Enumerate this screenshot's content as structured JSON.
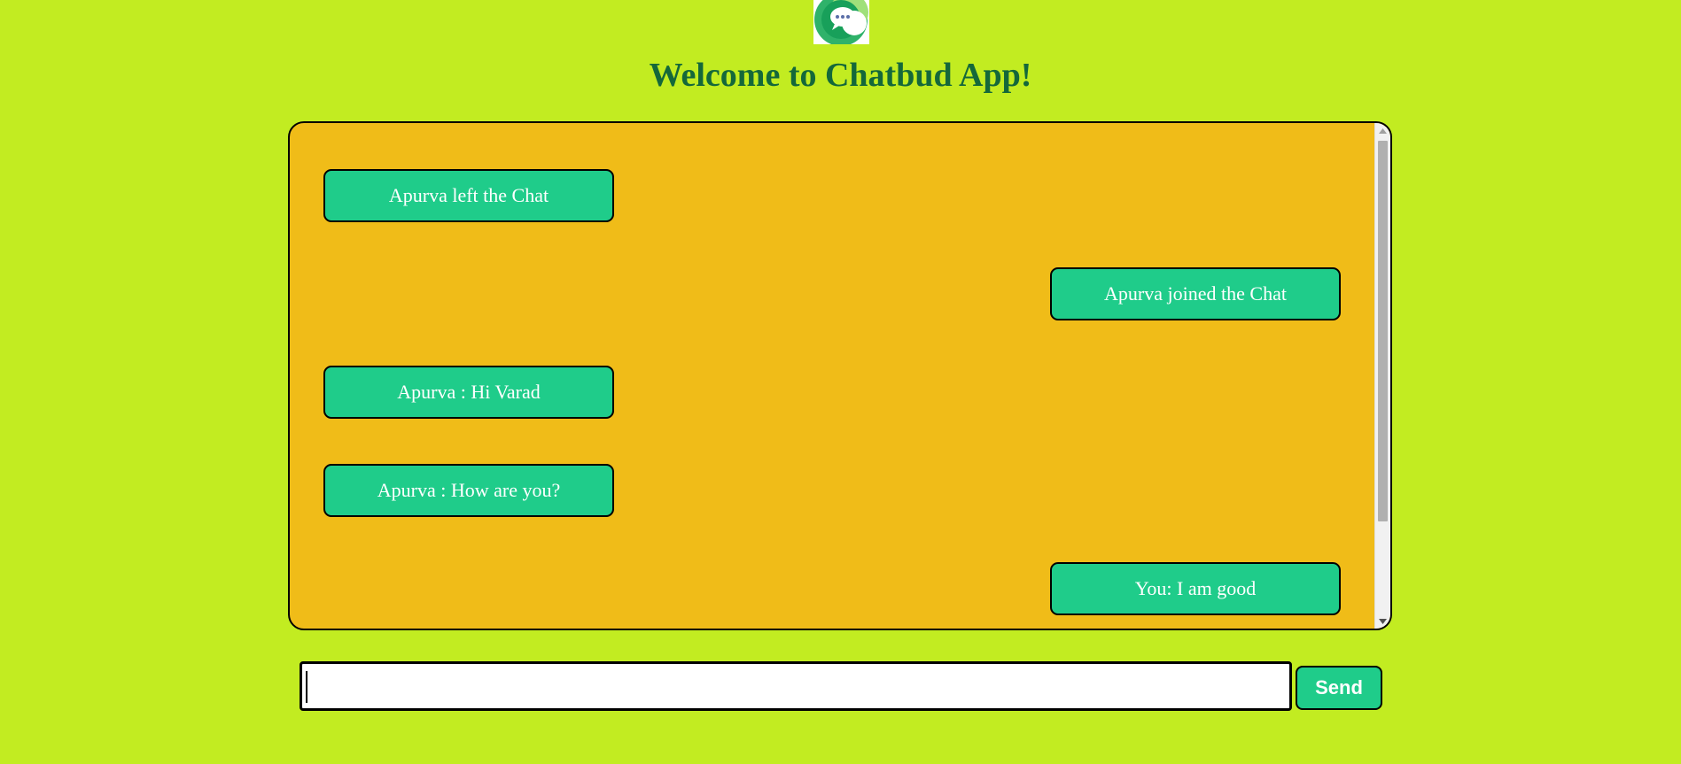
{
  "app": {
    "logo_icon": "chat-bubble-logo-icon",
    "title": "Welcome to Chatbud App!"
  },
  "chat": {
    "messages": [
      {
        "text": "Apurva left the Chat",
        "side": "left"
      },
      {
        "text": "Apurva joined the Chat",
        "side": "right"
      },
      {
        "text": "Apurva : Hi Varad",
        "side": "left"
      },
      {
        "text": "Apurva : How are you?",
        "side": "left"
      },
      {
        "text": "You: I am good",
        "side": "right"
      }
    ]
  },
  "composer": {
    "input_value": "",
    "input_placeholder": "",
    "send_label": "Send"
  },
  "colors": {
    "page_background": "#c2ec21",
    "chat_background": "#f0bc18",
    "bubble": "#1fcc8a",
    "title": "#14683a"
  }
}
